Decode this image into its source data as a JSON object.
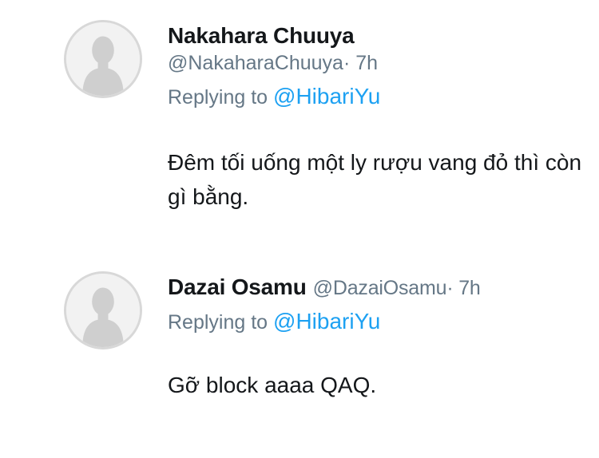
{
  "tweets": [
    {
      "author_name": "Nakahara Chuuya",
      "handle": "@NakaharaChuuya",
      "time": "· 7h",
      "replying_prefix": "Replying to",
      "replying_to": "@HibariYu",
      "text": "Đêm tối uống một ly rượu vang đỏ thì còn gì bằng.",
      "avatar_icon": "default-profile-silhouette"
    },
    {
      "author_name": "Dazai Osamu",
      "handle": "@DazaiOsamu",
      "time": "· 7h",
      "replying_prefix": "Replying to",
      "replying_to": "@HibariYu",
      "text": "Gỡ block aaaa QAQ.",
      "avatar_icon": "default-profile-silhouette"
    }
  ],
  "colors": {
    "text": "#14171a",
    "secondary": "#657786",
    "link": "#1da1f2",
    "avatar_bg": "#f2f2f2",
    "avatar_silhouette": "#cfcfcf"
  }
}
